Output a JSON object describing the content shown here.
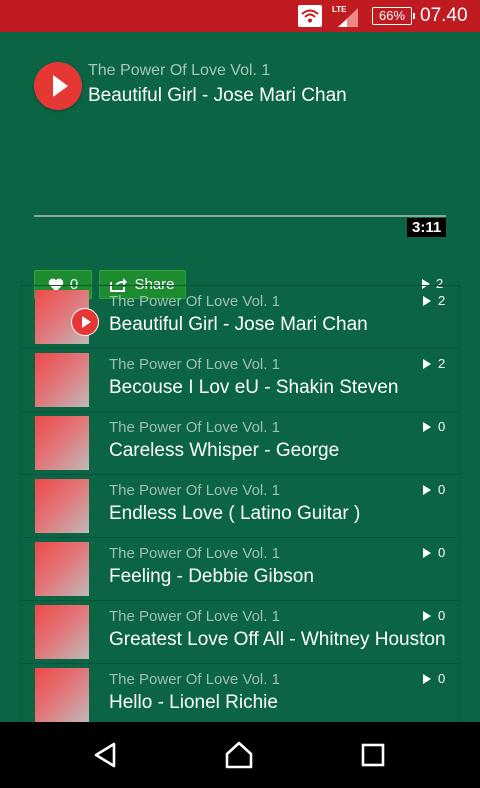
{
  "status_bar": {
    "battery": "66%",
    "time": "07.40",
    "network": "LTE",
    "icons": [
      "wifi-icon",
      "signal-icon",
      "battery-icon"
    ]
  },
  "now_playing": {
    "album": "The Power Of Love Vol. 1",
    "title": "Beautiful Girl - Jose Mari Chan",
    "duration": "3:11",
    "likes": "0",
    "share_label": "Share",
    "plays": "2"
  },
  "tracks": [
    {
      "album": "The Power Of Love Vol. 1",
      "title": "Beautiful Girl - Jose Mari Chan",
      "plays": "2",
      "playing": true
    },
    {
      "album": "The Power Of Love Vol. 1",
      "title": "Becouse I Lov eU - Shakin Steven",
      "plays": "2",
      "playing": false
    },
    {
      "album": "The Power Of Love Vol. 1",
      "title": "Careless Whisper - George",
      "plays": "0",
      "playing": false
    },
    {
      "album": "The Power Of Love Vol. 1",
      "title": "Endless Love ( Latino Guitar )",
      "plays": "0",
      "playing": false
    },
    {
      "album": "The Power Of Love Vol. 1",
      "title": "Feeling - Debbie Gibson",
      "plays": "0",
      "playing": false
    },
    {
      "album": "The Power Of Love Vol. 1",
      "title": "Greatest Love Off All - Whitney Houston",
      "plays": "0",
      "playing": false
    },
    {
      "album": "The Power Of Love Vol. 1",
      "title": "Hello - Lionel Richie",
      "plays": "0",
      "playing": false
    }
  ],
  "colors": {
    "background": "#0b6545",
    "status_bar": "#bf1b21",
    "accent_play": "#e53835",
    "button_green": "#1c8c2e"
  },
  "nav_bar": {
    "icons": [
      "back-icon",
      "home-icon",
      "recents-icon"
    ]
  }
}
